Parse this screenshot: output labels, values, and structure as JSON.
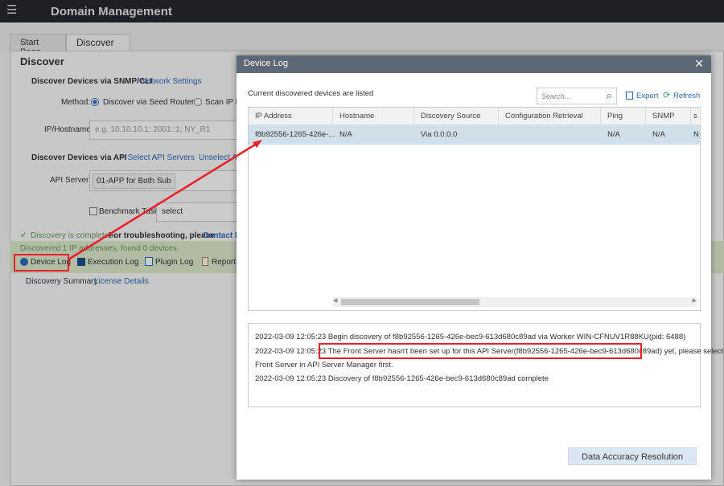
{
  "app": {
    "title": "Domain Management"
  },
  "tabs": [
    {
      "label": "Start Page"
    },
    {
      "label": "Discover"
    }
  ],
  "discover": {
    "title": "Discover",
    "snmp_heading": "Discover Devices via SNMP/CLI",
    "network_settings": "Network Settings",
    "method_label": "Method:",
    "method_seed": "Discover via Seed Routers",
    "method_scan": "Scan IP Ra",
    "ip_label": "IP/Hostname:",
    "ip_placeholder": "e.g. 10.10.10.1; 2001::1; NY_R1",
    "api_heading": "Discover Devices via API",
    "select_api": "+ Select API Servers",
    "unselect_api": "Unselect A",
    "api_servers_label": "API Servers:",
    "api_server_chip": "01-APP for Both Sub",
    "benchmark_label": "Benchmark Task",
    "benchmark_select": "select",
    "status_completed": "Discovery is completed.",
    "troubleshoot": "For troubleshooting, please",
    "contact": "Contact N",
    "found": "Discovered 1 IP addresses, found 0 devices.",
    "device_log": "Device Log",
    "execution_log": "Execution Log",
    "plugin_log": "Plugin Log",
    "report": "Report",
    "summary": "Discovery Summary",
    "license": "License Details"
  },
  "modal": {
    "title": "Device Log",
    "subtitle": "Current discovered devices are listed",
    "search_placeholder": "Search...",
    "export": "Export",
    "refresh": "Refresh",
    "columns": [
      "IP Address",
      "Hostname",
      "Discovery Source",
      "Configuration Retrieval",
      "Ping",
      "SNMP",
      "s"
    ],
    "rows": [
      [
        "f8b92556-1265-426e-...",
        "N/A",
        "Via 0.0.0.0",
        "",
        "N/A",
        "N/A",
        "N"
      ]
    ],
    "log": [
      "2022-03-09 12:05:23 Begin discovery of f8b92556-1265-426e-bec9-613d680c89ad via Worker WIN-CFNUV1R88KU(pid: 6488)",
      "2022-03-09 12:05:23 The Front Server hasn't been set up for this API Server(f8b92556-1265-426e-bec9-613d680c89ad) yet, please select a",
      "Front Server in API Server Manager first.",
      "2022-03-09 12:05:23 Discovery of f8b92556-1265-426e-bec9-613d680c89ad complete"
    ],
    "accuracy_button": "Data Accuracy Resolution"
  }
}
